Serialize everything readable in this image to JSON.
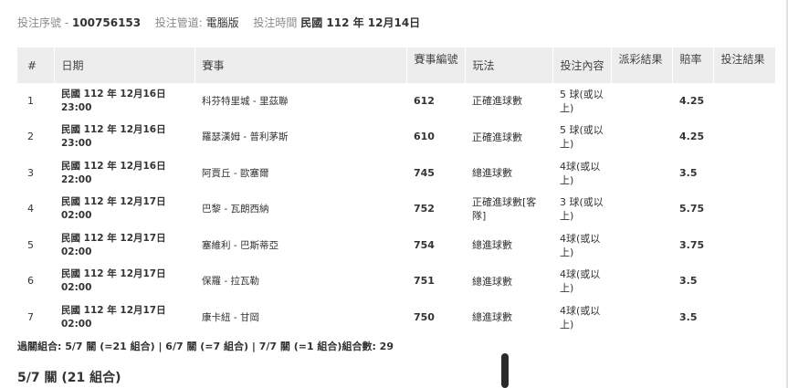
{
  "header": {
    "serial_label": "投注序號 -",
    "serial_value": "100756153",
    "channel_label": "投注管道:",
    "channel_value": "電腦版",
    "time_label": "投注時間",
    "time_value": "民國 112 年 12月14日"
  },
  "table": {
    "columns": [
      "#",
      "日期",
      "賽事",
      "賽事編號",
      "玩法",
      "投注內容",
      "派彩結果",
      "賠率",
      "投注結果"
    ],
    "rows": [
      {
        "num": "1",
        "date": "民國 112 年 12月16日",
        "time": "23:00",
        "match": "科芬特里城 - 里茲聯",
        "code": "612",
        "play": "正確進球數",
        "content": "5 球(或以上)",
        "payout": "",
        "odds": "4.25",
        "result": ""
      },
      {
        "num": "2",
        "date": "民國 112 年 12月16日",
        "time": "23:00",
        "match": "羅瑟漢姆 - 普利茅斯",
        "code": "610",
        "play": "正確進球數",
        "content": "5 球(或以上)",
        "payout": "",
        "odds": "4.25",
        "result": ""
      },
      {
        "num": "3",
        "date": "民國 112 年 12月16日",
        "time": "22:00",
        "match": "阿賈丘 - 歐塞爾",
        "code": "745",
        "play": "總進球數",
        "content": "4球(或以上)",
        "payout": "",
        "odds": "3.5",
        "result": ""
      },
      {
        "num": "4",
        "date": "民國 112 年 12月17日",
        "time": "02:00",
        "match": "巴黎 - 瓦朗西納",
        "code": "752",
        "play": "正確進球數[客隊]",
        "content": "3 球(或以上)",
        "payout": "",
        "odds": "5.75",
        "result": ""
      },
      {
        "num": "5",
        "date": "民國 112 年 12月17日",
        "time": "02:00",
        "match": "塞維利 - 巴斯蒂亞",
        "code": "754",
        "play": "總進球數",
        "content": "4球(或以上)",
        "payout": "",
        "odds": "3.75",
        "result": ""
      },
      {
        "num": "6",
        "date": "民國 112 年 12月17日",
        "time": "02:00",
        "match": "保羅 - 拉瓦勒",
        "code": "751",
        "play": "總進球數",
        "content": "4球(或以上)",
        "payout": "",
        "odds": "3.5",
        "result": ""
      },
      {
        "num": "7",
        "date": "民國 112 年 12月17日",
        "time": "02:00",
        "match": "康卡紐 - 甘岡",
        "code": "750",
        "play": "總進球數",
        "content": "4球(或以上)",
        "payout": "",
        "odds": "3.5",
        "result": ""
      }
    ]
  },
  "summary": "過關組合: 5/7 關 (=21 組合) | 6/7 關 (=7 組合) | 7/7 關 (=1 組合)組合數: 29",
  "section_title": "5/7 關 (21 組合)"
}
